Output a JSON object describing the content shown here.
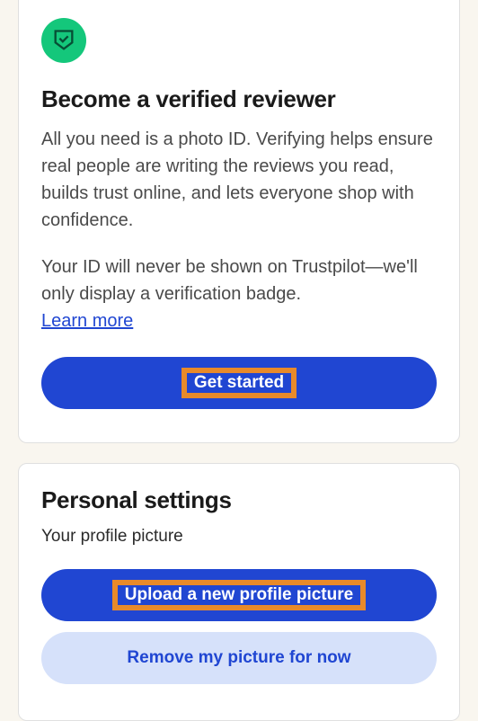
{
  "verified_card": {
    "title": "Become a verified reviewer",
    "description": "All you need is a photo ID. Verifying helps ensure real people are writing the reviews you read, builds trust online, and lets everyone shop with confidence.",
    "note": "Your ID will never be shown on Trustpilot—we'll only display a verification badge.",
    "learn_more": "Learn more",
    "button": "Get started"
  },
  "personal_card": {
    "title": "Personal settings",
    "subtitle": "Your profile picture",
    "upload_button": "Upload a new profile picture",
    "remove_button": "Remove my picture for now"
  },
  "colors": {
    "accent_green": "#14c77b",
    "primary_blue": "#2046d2",
    "secondary_blue_bg": "#d6e1fa",
    "highlight_orange": "#e88a2a"
  }
}
